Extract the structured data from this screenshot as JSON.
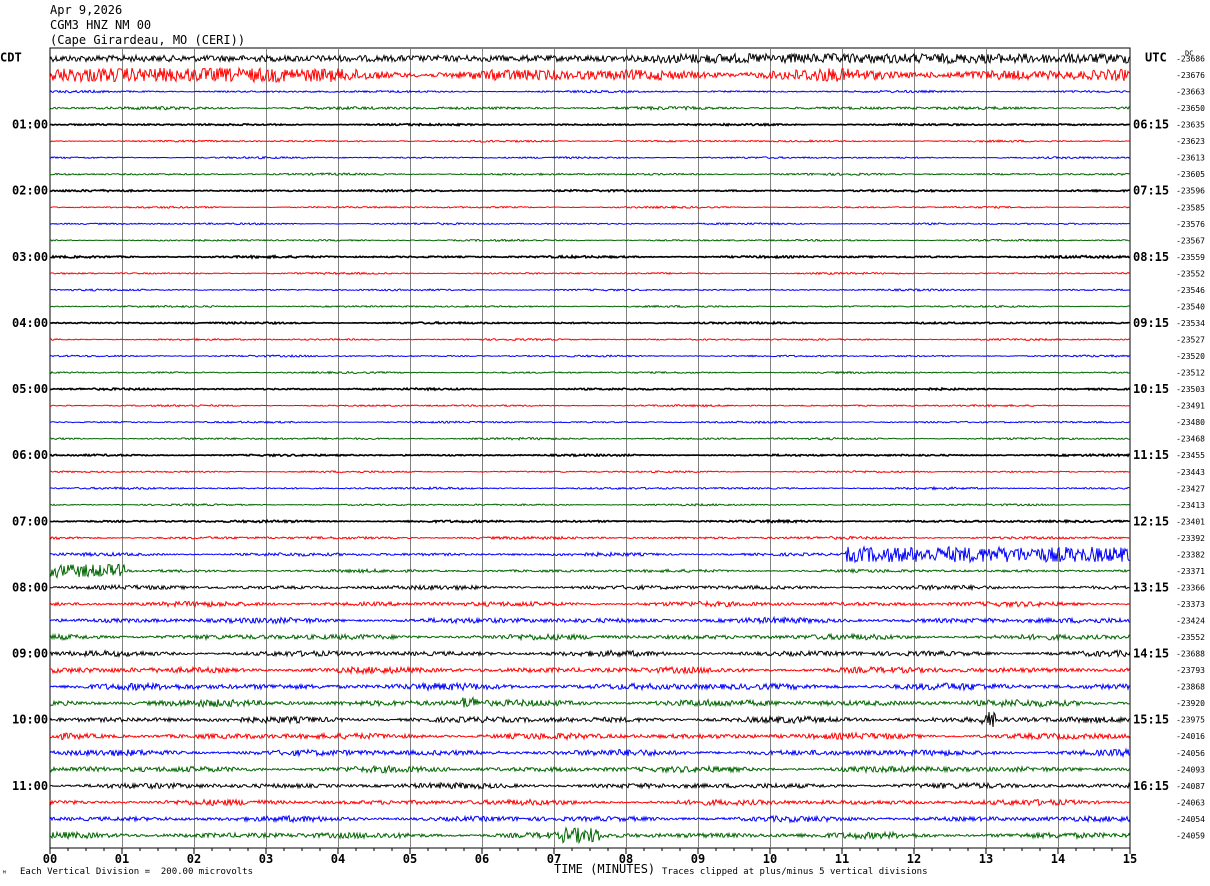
{
  "header": {
    "date": "Apr 9,2026",
    "station": "CGM3 HNZ NM 00",
    "location": "(Cape Girardeau, MO (CERI))"
  },
  "left_tz": "CDT",
  "right_tz": "UTC",
  "right_col_label": "DC",
  "footer": {
    "scale": "Each Vertical Division =  200.00 microvolts",
    "clip": "Traces clipped at plus/minus 5 vertical divisions",
    "mark": "ᴹ"
  },
  "chart_data": {
    "type": "helicorder",
    "title": "",
    "xlabel": "TIME (MINUTES)",
    "ylabel": "",
    "x_range": [
      0,
      15
    ],
    "x_ticks": [
      "00",
      "01",
      "02",
      "03",
      "04",
      "05",
      "06",
      "07",
      "08",
      "09",
      "10",
      "11",
      "12",
      "13",
      "14",
      "15"
    ],
    "grid": true,
    "trace_interval_minutes": 15,
    "trace_colors": [
      "#000000",
      "#ff0000",
      "#0000ff",
      "#006600"
    ],
    "left_hour_labels": [
      "01:00",
      "02:00",
      "03:00",
      "04:00",
      "05:00",
      "06:00",
      "07:00",
      "08:00",
      "09:00",
      "10:00",
      "11:00"
    ],
    "right_hour_labels": [
      "06:15",
      "07:15",
      "08:15",
      "09:15",
      "10:15",
      "11:15",
      "12:15",
      "13:15",
      "14:15",
      "15:15",
      "16:15"
    ],
    "trace_dc_offsets": [
      -23686,
      -23676,
      -23663,
      -23650,
      -23635,
      -23623,
      -23613,
      -23605,
      -23596,
      -23585,
      -23576,
      -23567,
      -23559,
      -23552,
      -23546,
      -23540,
      -23534,
      -23527,
      -23520,
      -23512,
      -23503,
      -23491,
      -23480,
      -23468,
      -23455,
      -23443,
      -23427,
      -23413,
      -23401,
      -23392,
      -23382,
      -23371,
      -23366,
      -23373,
      -23424,
      -23552,
      -23688,
      -23793,
      -23868,
      -23920,
      -23975,
      -24016,
      -24056,
      -24093,
      -24087,
      -24063,
      -24054,
      -24059
    ],
    "trace_noise_level": [
      1.2,
      2.0,
      0.35,
      0.5,
      0.3,
      0.3,
      0.3,
      0.35,
      0.3,
      0.3,
      0.3,
      0.3,
      0.35,
      0.3,
      0.3,
      0.3,
      0.3,
      0.3,
      0.3,
      0.3,
      0.3,
      0.3,
      0.3,
      0.35,
      0.3,
      0.3,
      0.35,
      0.3,
      0.35,
      0.45,
      0.55,
      0.5,
      0.7,
      0.8,
      0.9,
      0.9,
      0.9,
      1.0,
      1.1,
      1.1,
      1.0,
      1.0,
      1.0,
      1.0,
      0.9,
      0.9,
      0.9,
      1.0
    ]
  }
}
